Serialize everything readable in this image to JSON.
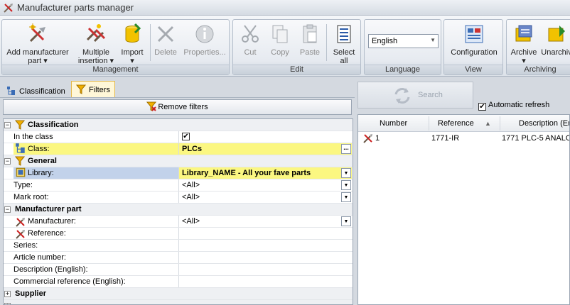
{
  "window": {
    "title": "Manufacturer parts manager"
  },
  "ribbon": {
    "management": {
      "label": "Management",
      "add_line1": "Add manufacturer",
      "add_line2": "part ▾",
      "multiple_line1": "Multiple",
      "multiple_line2": "insertion ▾",
      "import_line1": "Import",
      "import_line2": "▾",
      "delete": "Delete",
      "properties": "Properties..."
    },
    "edit": {
      "label": "Edit",
      "cut": "Cut",
      "copy": "Copy",
      "paste": "Paste",
      "select_line1": "Select",
      "select_line2": "all"
    },
    "language": {
      "label": "Language",
      "selected": "English"
    },
    "view": {
      "label": "View",
      "configuration": "Configuration"
    },
    "archiving": {
      "label": "Archiving",
      "archive_line1": "Archive",
      "archive_line2": "▾",
      "unarchive": "Unarchiv"
    }
  },
  "tabs": {
    "classification": "Classification",
    "filters": "Filters"
  },
  "remove_filters": "Remove filters",
  "filters": {
    "cat_classification": "Classification",
    "in_the_class": "In the class",
    "in_the_class_checked": "✔",
    "class_label": "Class:",
    "class_value": "PLCs",
    "cat_general": "General",
    "library_label": "Library:",
    "library_value": "Library_NAME - All your fave parts",
    "type_label": "Type:",
    "type_value": "<All>",
    "mark_root_label": "Mark root:",
    "mark_root_value": "<All>",
    "cat_manufacturer_part": "Manufacturer part",
    "manufacturer_label": "Manufacturer:",
    "manufacturer_value": "<All>",
    "reference_label": "Reference:",
    "series_label": "Series:",
    "article_number_label": "Article number:",
    "description_label": "Description (English):",
    "commercial_reference_label": "Commercial reference (English):",
    "cat_supplier": "Supplier",
    "expand_minus": "−",
    "expand_plus": "+",
    "ellipsis": "..."
  },
  "search": {
    "button": "Search",
    "auto_refresh": "Automatic refresh",
    "auto_refresh_checked": "✔"
  },
  "results": {
    "columns": [
      "Number",
      "Reference",
      "Description (En"
    ],
    "sort_indicator": "▲",
    "rows": [
      {
        "number": "1",
        "reference": "1771-IR",
        "description": "1771 PLC-5 ANALOG"
      }
    ]
  },
  "colors": {
    "highlight_row": "#fbf781",
    "selected_label": "#c2d2ea",
    "active_tab": "#fff7d8"
  }
}
